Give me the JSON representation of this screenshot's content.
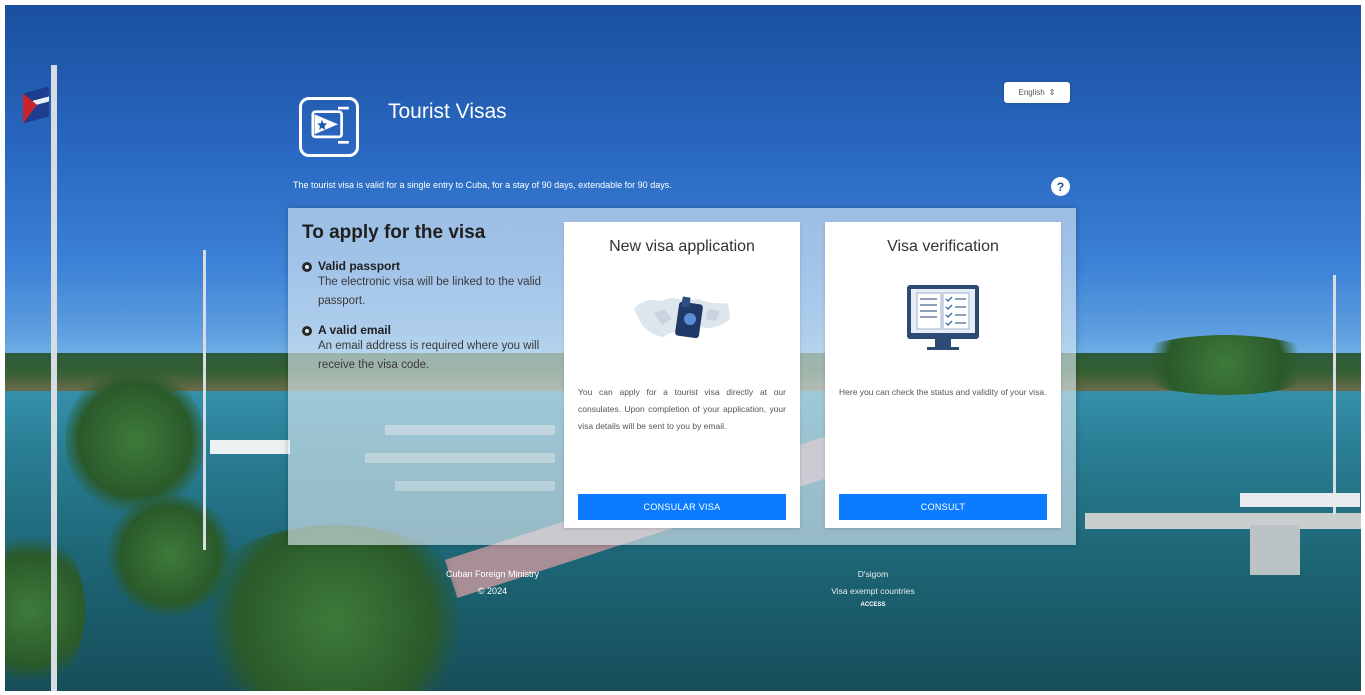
{
  "header": {
    "title": "Tourist Visas",
    "subtitle": "The tourist visa is valid for a single entry to Cuba, for a stay of 90 days, extendable for 90 days.",
    "language_selected": "English",
    "help_symbol": "?"
  },
  "requirements": {
    "heading": "To apply for the visa",
    "items": [
      {
        "title": "Valid passport",
        "description": "The electronic visa will be linked to the valid passport."
      },
      {
        "title": "A valid email",
        "description": "An email address is required where you will receive the visa code."
      }
    ]
  },
  "cards": {
    "new_application": {
      "title": "New visa application",
      "description": "You can apply for a tourist visa directly at our consulates. Upon completion of your application, your visa details will be sent to you by email.",
      "button_label": "CONSULAR VISA",
      "icon": "passport-map-icon"
    },
    "verification": {
      "title": "Visa verification",
      "description": "Here you can check the status and validity of your visa.",
      "button_label": "CONSULT",
      "icon": "monitor-checklist-icon"
    }
  },
  "footer": {
    "org": "Cuban Foreign Ministry",
    "year": "© 2024",
    "links": [
      "D'sigom",
      "Visa exempt countries"
    ],
    "small": "ACCESS"
  },
  "colors": {
    "button": "#0b7cff",
    "panel": "#e1ebf3",
    "background_sky": "#2a69c2"
  }
}
